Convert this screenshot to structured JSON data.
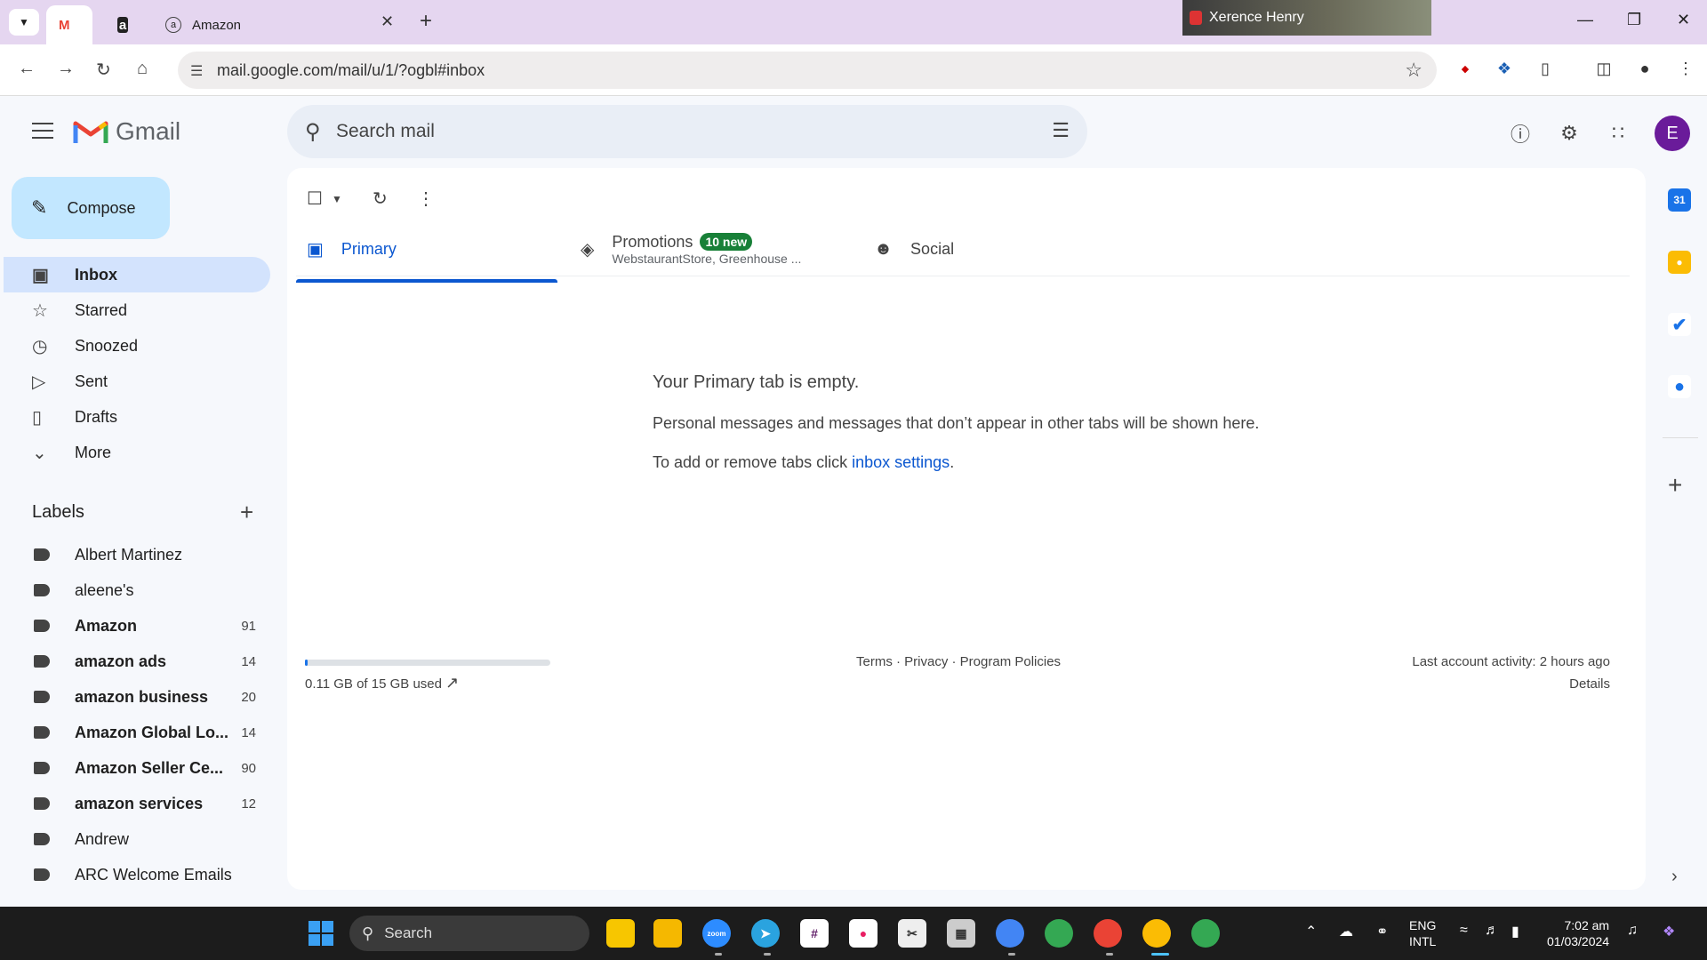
{
  "browser": {
    "tabs": [
      {
        "label": "",
        "icon": "gmail-icon"
      },
      {
        "label": "",
        "icon": "amazon-icon"
      },
      {
        "label": "Amazon",
        "icon": "amazon-smile-icon"
      }
    ],
    "url": "mail.google.com/mail/u/1/?ogbl#inbox",
    "meeting_participant": "Xerence Henry"
  },
  "gmail": {
    "brand": "Gmail",
    "search_placeholder": "Search mail",
    "avatar_letter": "E",
    "compose_label": "Compose",
    "nav": [
      {
        "label": "Inbox",
        "icon": "inbox-icon"
      },
      {
        "label": "Starred",
        "icon": "star-icon"
      },
      {
        "label": "Snoozed",
        "icon": "clock-icon"
      },
      {
        "label": "Sent",
        "icon": "send-icon"
      },
      {
        "label": "Drafts",
        "icon": "draft-icon"
      },
      {
        "label": "More",
        "icon": "chevron-down-icon"
      }
    ],
    "labels_heading": "Labels",
    "labels": [
      {
        "name": "Albert Martinez",
        "count": ""
      },
      {
        "name": "aleene's",
        "count": ""
      },
      {
        "name": "Amazon",
        "count": "91"
      },
      {
        "name": "amazon ads",
        "count": "14"
      },
      {
        "name": "amazon business",
        "count": "20"
      },
      {
        "name": "Amazon Global Lo...",
        "count": "14"
      },
      {
        "name": "Amazon Seller Ce...",
        "count": "90"
      },
      {
        "name": "amazon services",
        "count": "12"
      },
      {
        "name": "Andrew",
        "count": ""
      },
      {
        "name": "ARC Welcome Emails",
        "count": ""
      }
    ],
    "inbox_tabs": {
      "primary": "Primary",
      "promotions": "Promotions",
      "promotions_badge": "10 new",
      "promotions_senders": "WebstaurantStore, Greenhouse ...",
      "social": "Social"
    },
    "empty": {
      "title": "Your Primary tab is empty.",
      "line1": "Personal messages and messages that don’t appear in other tabs will be shown here.",
      "line2_prefix": "To add or remove tabs click ",
      "line2_link": "inbox settings",
      "line2_suffix": "."
    },
    "footer": {
      "storage": "0.11 GB of 15 GB used",
      "storage_fraction": 0.0073,
      "links": "Terms · Privacy · Program Policies",
      "activity": "Last account activity: 2 hours ago",
      "details": "Details"
    }
  },
  "taskbar": {
    "search": "Search",
    "lang_top": "ENG",
    "lang_bottom": "INTL",
    "time": "7:02 am",
    "date": "01/03/2024"
  }
}
